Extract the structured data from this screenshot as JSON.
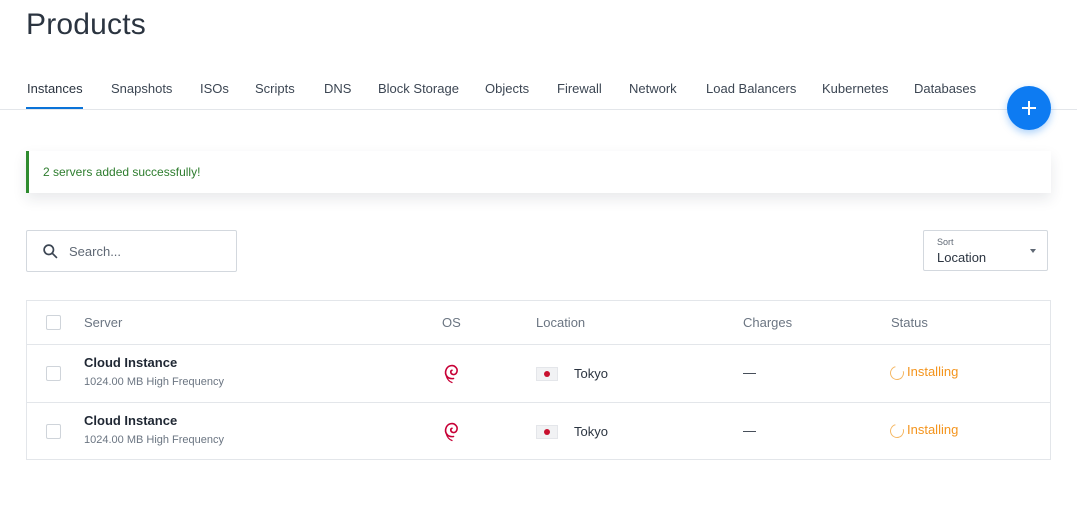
{
  "page": {
    "title": "Products"
  },
  "tabs": [
    {
      "label": "Instances",
      "active": true
    },
    {
      "label": "Snapshots"
    },
    {
      "label": "ISOs"
    },
    {
      "label": "Scripts"
    },
    {
      "label": "DNS"
    },
    {
      "label": "Block Storage"
    },
    {
      "label": "Objects"
    },
    {
      "label": "Firewall"
    },
    {
      "label": "Network"
    },
    {
      "label": "Load Balancers"
    },
    {
      "label": "Kubernetes"
    },
    {
      "label": "Databases"
    }
  ],
  "fab": {
    "icon": "plus-icon"
  },
  "alert": {
    "message": "2 servers added successfully!",
    "color": "#2e8b2e"
  },
  "search": {
    "placeholder": "Search...",
    "value": ""
  },
  "sort": {
    "label": "Sort",
    "value": "Location"
  },
  "table": {
    "columns": [
      "Server",
      "OS",
      "Location",
      "Charges",
      "Status"
    ],
    "rows": [
      {
        "name": "Cloud Instance",
        "plan": "1024.00 MB High Frequency",
        "os_icon": "debian-icon",
        "flag": "japan-flag-icon",
        "location": "Tokyo",
        "charges": "—",
        "status": "Installing"
      },
      {
        "name": "Cloud Instance",
        "plan": "1024.00 MB High Frequency",
        "os_icon": "debian-icon",
        "flag": "japan-flag-icon",
        "location": "Tokyo",
        "charges": "—",
        "status": "Installing"
      }
    ]
  },
  "colors": {
    "accent": "#0d7bf2",
    "status_installing": "#f4941c",
    "debian": "#c70036"
  }
}
